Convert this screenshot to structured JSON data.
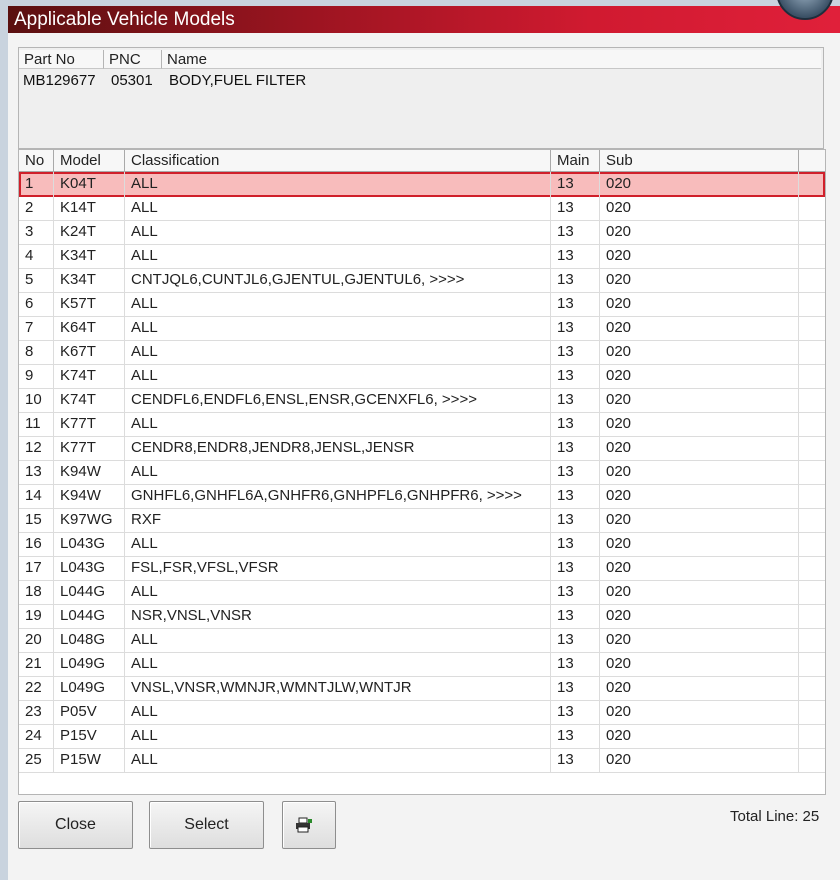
{
  "window": {
    "title": "Applicable Vehicle Models"
  },
  "part": {
    "headers": {
      "part_no": "Part No",
      "pnc": "PNC",
      "name": "Name"
    },
    "part_no": "MB129677",
    "pnc": "05301",
    "name": "BODY,FUEL FILTER"
  },
  "table": {
    "columns": [
      "No",
      "Model",
      "Classification",
      "Main",
      "Sub"
    ],
    "selected_index": 0,
    "rows": [
      {
        "no": "1",
        "model": "K04T",
        "classification": "ALL",
        "main": "13",
        "sub": "020"
      },
      {
        "no": "2",
        "model": "K14T",
        "classification": "ALL",
        "main": "13",
        "sub": "020"
      },
      {
        "no": "3",
        "model": "K24T",
        "classification": "ALL",
        "main": "13",
        "sub": "020"
      },
      {
        "no": "4",
        "model": "K34T",
        "classification": "ALL",
        "main": "13",
        "sub": "020"
      },
      {
        "no": "5",
        "model": "K34T",
        "classification": "CNTJQL6,CUNTJL6,GJENTUL,GJENTUL6,  >>>>",
        "main": "13",
        "sub": "020"
      },
      {
        "no": "6",
        "model": "K57T",
        "classification": "ALL",
        "main": "13",
        "sub": "020"
      },
      {
        "no": "7",
        "model": "K64T",
        "classification": "ALL",
        "main": "13",
        "sub": "020"
      },
      {
        "no": "8",
        "model": "K67T",
        "classification": "ALL",
        "main": "13",
        "sub": "020"
      },
      {
        "no": "9",
        "model": "K74T",
        "classification": "ALL",
        "main": "13",
        "sub": "020"
      },
      {
        "no": "10",
        "model": "K74T",
        "classification": "CENDFL6,ENDFL6,ENSL,ENSR,GCENXFL6,  >>>>",
        "main": "13",
        "sub": "020"
      },
      {
        "no": "11",
        "model": "K77T",
        "classification": "ALL",
        "main": "13",
        "sub": "020"
      },
      {
        "no": "12",
        "model": "K77T",
        "classification": "CENDR8,ENDR8,JENDR8,JENSL,JENSR",
        "main": "13",
        "sub": "020"
      },
      {
        "no": "13",
        "model": "K94W",
        "classification": "ALL",
        "main": "13",
        "sub": "020"
      },
      {
        "no": "14",
        "model": "K94W",
        "classification": "GNHFL6,GNHFL6A,GNHFR6,GNHPFL6,GNHPFR6,  >>>>",
        "main": "13",
        "sub": "020"
      },
      {
        "no": "15",
        "model": "K97WG",
        "classification": "RXF",
        "main": "13",
        "sub": "020"
      },
      {
        "no": "16",
        "model": "L043G",
        "classification": "ALL",
        "main": "13",
        "sub": "020"
      },
      {
        "no": "17",
        "model": "L043G",
        "classification": "FSL,FSR,VFSL,VFSR",
        "main": "13",
        "sub": "020"
      },
      {
        "no": "18",
        "model": "L044G",
        "classification": "ALL",
        "main": "13",
        "sub": "020"
      },
      {
        "no": "19",
        "model": "L044G",
        "classification": "NSR,VNSL,VNSR",
        "main": "13",
        "sub": "020"
      },
      {
        "no": "20",
        "model": "L048G",
        "classification": "ALL",
        "main": "13",
        "sub": "020"
      },
      {
        "no": "21",
        "model": "L049G",
        "classification": "ALL",
        "main": "13",
        "sub": "020"
      },
      {
        "no": "22",
        "model": "L049G",
        "classification": "VNSL,VNSR,WMNJR,WMNTJLW,WNTJR",
        "main": "13",
        "sub": "020"
      },
      {
        "no": "23",
        "model": "P05V",
        "classification": "ALL",
        "main": "13",
        "sub": "020"
      },
      {
        "no": "24",
        "model": "P15V",
        "classification": "ALL",
        "main": "13",
        "sub": "020"
      },
      {
        "no": "25",
        "model": "P15W",
        "classification": "ALL",
        "main": "13",
        "sub": "020"
      }
    ]
  },
  "buttons": {
    "close": "Close",
    "select": "Select",
    "print_icon": "printer-icon"
  },
  "footer": {
    "total": "Total Line: 25"
  },
  "colors": {
    "title_start": "#5a1010",
    "title_end": "#e0203a",
    "selected_row": "#f8bcbc",
    "selected_border": "#d01f2a"
  }
}
